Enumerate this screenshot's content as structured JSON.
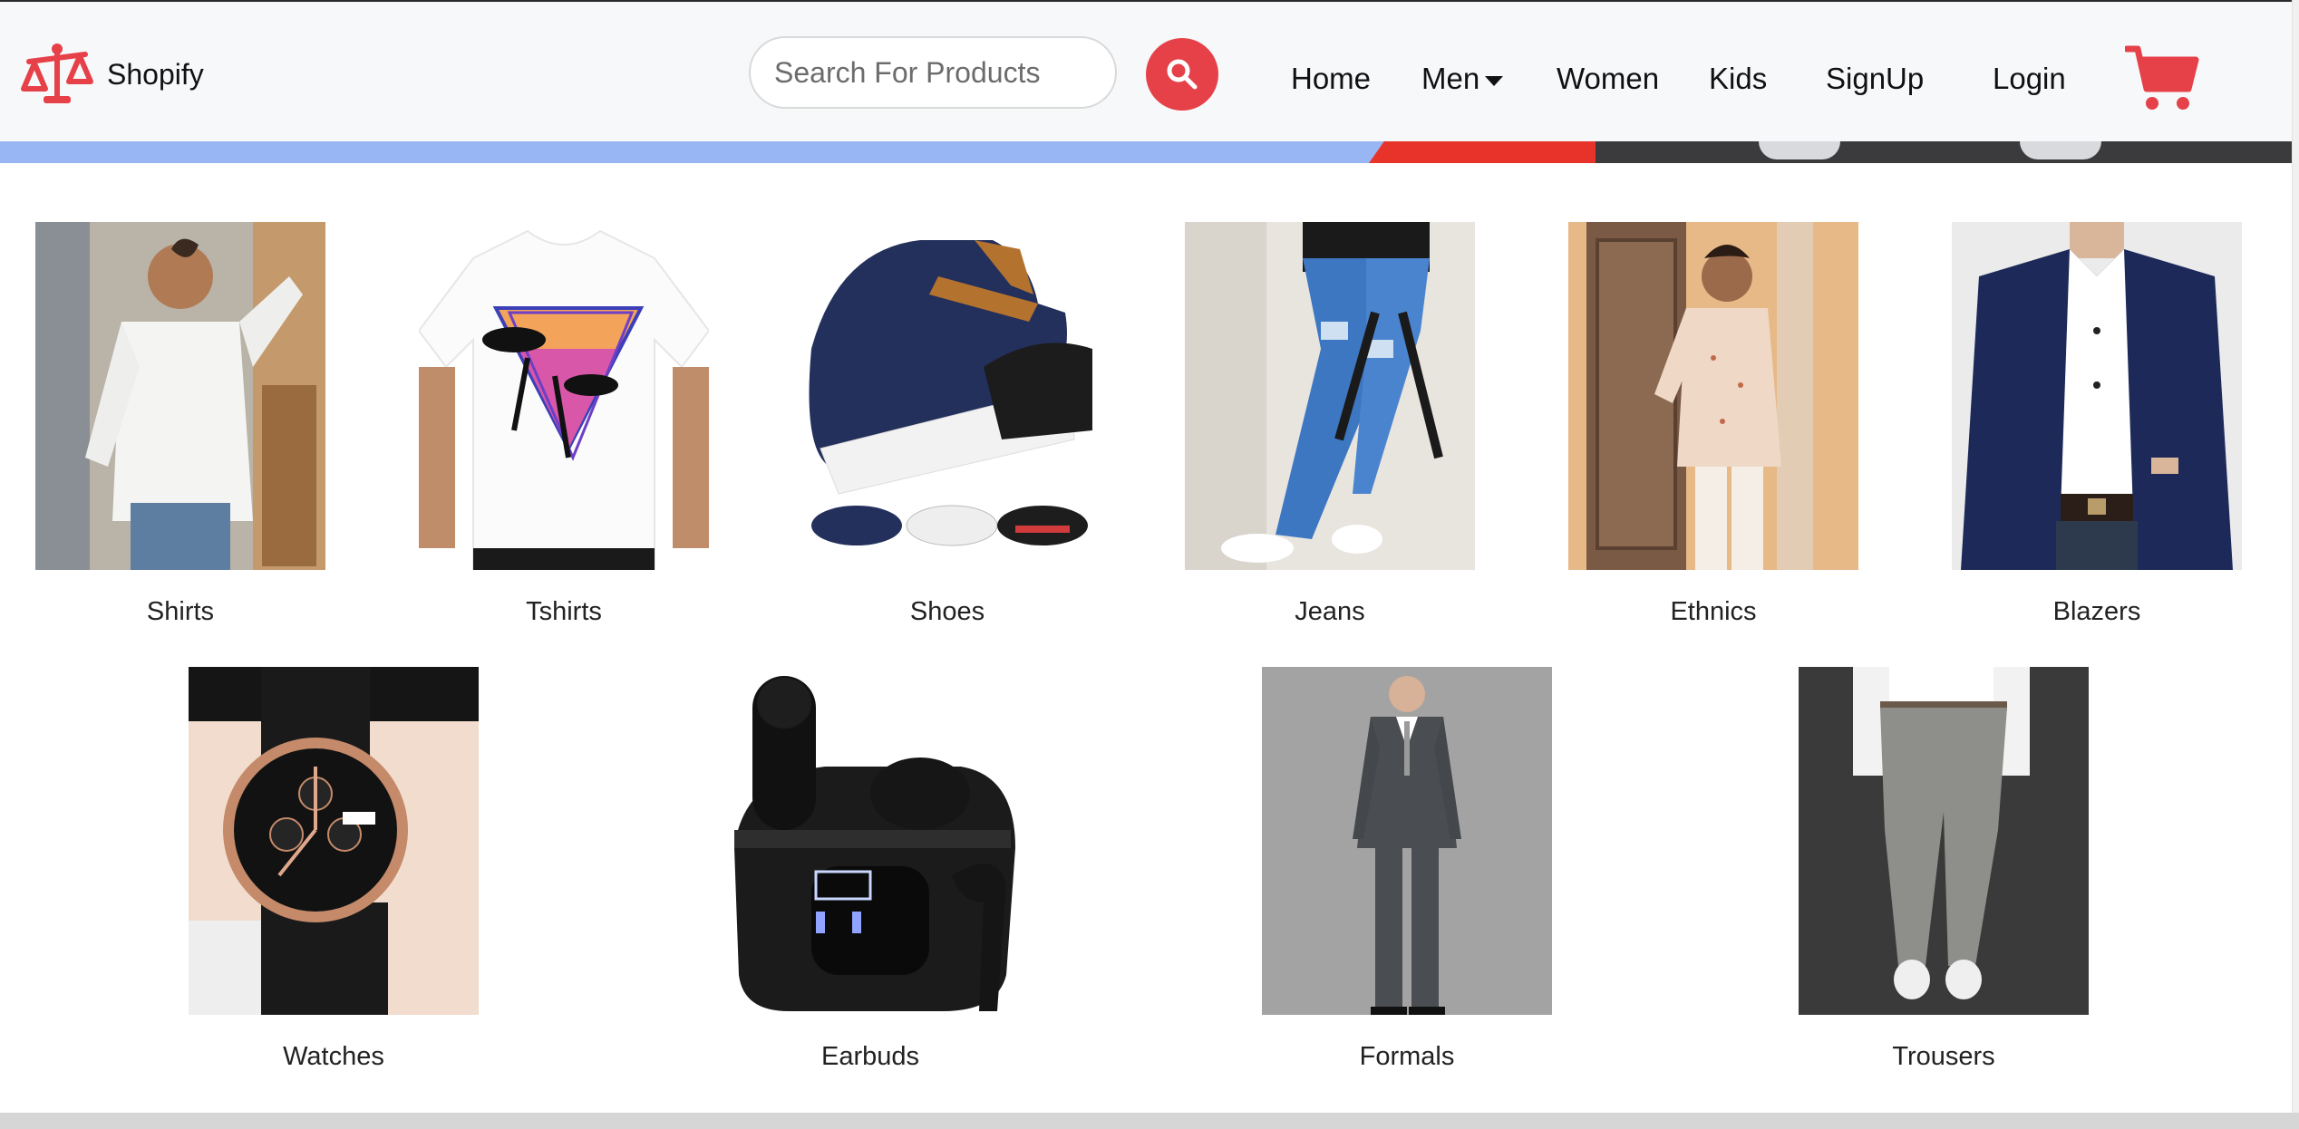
{
  "brand": {
    "name": "Shopify",
    "icon": "scale-icon",
    "accent": "#e64149"
  },
  "search": {
    "placeholder": "Search For Products",
    "value": ""
  },
  "nav": {
    "home": "Home",
    "men": "Men",
    "women": "Women",
    "kids": "Kids",
    "signup": "SignUp",
    "login": "Login"
  },
  "categories_row1": [
    {
      "label": "Shirts",
      "icon": "shirt-photo"
    },
    {
      "label": "Tshirts",
      "icon": "tshirt-photo"
    },
    {
      "label": "Shoes",
      "icon": "shoes-photo"
    },
    {
      "label": "Jeans",
      "icon": "jeans-photo"
    },
    {
      "label": "Ethnics",
      "icon": "ethnic-photo"
    },
    {
      "label": "Blazers",
      "icon": "blazer-photo"
    }
  ],
  "categories_row2": [
    {
      "label": "Watches",
      "icon": "watch-photo"
    },
    {
      "label": "Earbuds",
      "icon": "earbuds-photo"
    },
    {
      "label": "Formals",
      "icon": "suit-photo"
    },
    {
      "label": "Trousers",
      "icon": "trousers-photo"
    }
  ]
}
